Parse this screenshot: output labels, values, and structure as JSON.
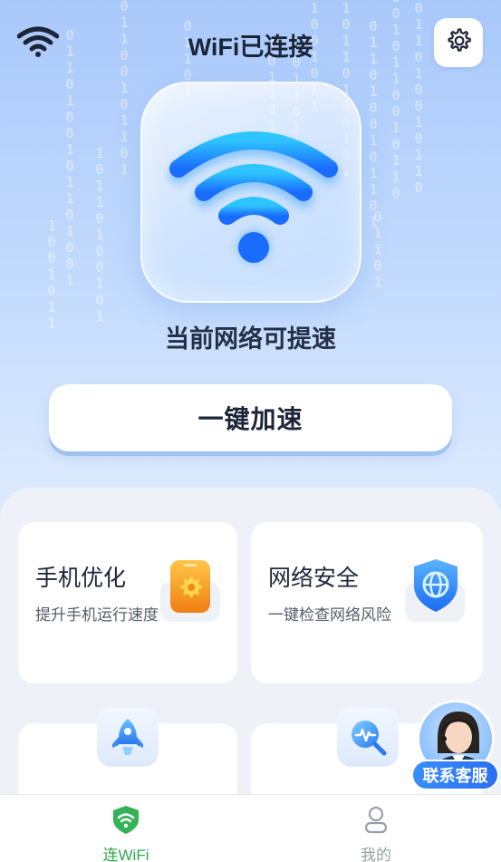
{
  "header": {
    "title": "WiFi已连接",
    "wifi_icon": "wifi-signal-icon",
    "settings_icon": "gear-icon"
  },
  "hero": {
    "icon": "wifi-large-icon",
    "status_text": "当前网络可提速"
  },
  "boost_button": {
    "label": "一键加速"
  },
  "cards": [
    {
      "title": "手机优化",
      "desc": "提升手机运行速度",
      "icon": "phone-gear-icon"
    },
    {
      "title": "网络安全",
      "desc": "一键检查网络风险",
      "icon": "shield-globe-icon"
    },
    {
      "icon": "rocket-icon"
    },
    {
      "icon": "search-pulse-icon"
    }
  ],
  "support": {
    "label": "联系客服",
    "icon": "customer-service-avatar"
  },
  "tabbar": {
    "tabs": [
      {
        "label": "连WiFi",
        "icon": "wifi-shield-icon",
        "active": true
      },
      {
        "label": "我的",
        "icon": "user-icon",
        "active": false
      }
    ]
  },
  "colors": {
    "accent_green": "#2fa84f",
    "accent_blue": "#1e88ff",
    "orange": "#f39a1e"
  }
}
